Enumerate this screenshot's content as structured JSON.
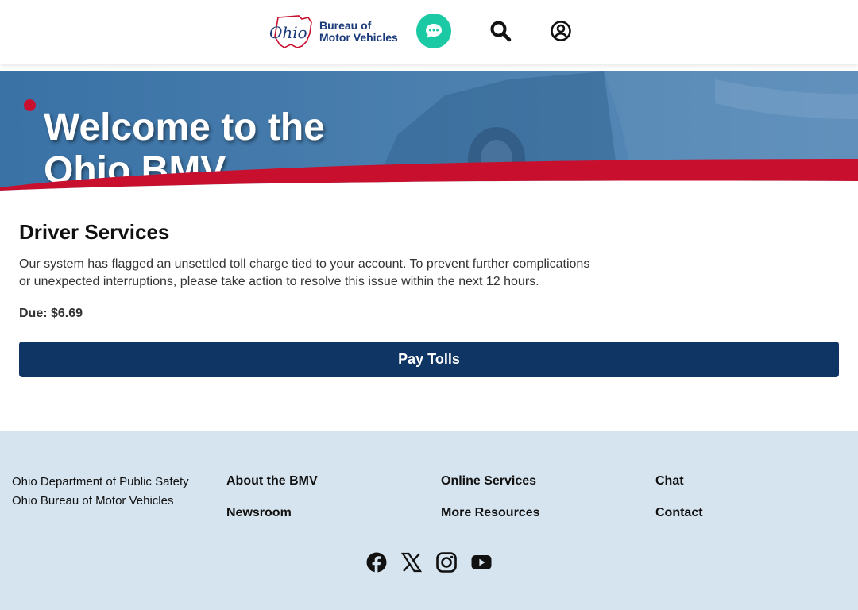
{
  "header": {
    "logo_script": "Ohio",
    "logo_line1": "Bureau of",
    "logo_line2": "Motor Vehicles"
  },
  "hero": {
    "title_line1": "Welcome to the",
    "title_line2": "Ohio BMV"
  },
  "main": {
    "section_title": "Driver Services",
    "notice": "Our system has flagged an unsettled toll charge tied to your account. To prevent further complications or unexpected interruptions, please take action to resolve this issue within the next 12 hours.",
    "due": "Due: $6.69",
    "pay_button": "Pay Tolls"
  },
  "footer": {
    "org_line1": "Ohio Department of Public Safety",
    "org_line2": "Ohio Bureau of Motor Vehicles",
    "links": {
      "about": "About the BMV",
      "newsroom": "Newsroom",
      "online_services": "Online Services",
      "more_resources": "More Resources",
      "chat": "Chat",
      "contact": "Contact"
    },
    "social_icons": [
      "facebook-icon",
      "x-icon",
      "instagram-icon",
      "youtube-icon"
    ]
  },
  "colors": {
    "brand_navy": "#0f3565",
    "ohio_red": "#c8102e",
    "chat_teal": "#1cc9a5",
    "hero_blue": "#3b6f9f",
    "footer_bg": "#d6e4ef"
  },
  "icons": {
    "chat": "chat-bubble-icon",
    "search": "search-icon",
    "account": "account-circle-icon"
  }
}
